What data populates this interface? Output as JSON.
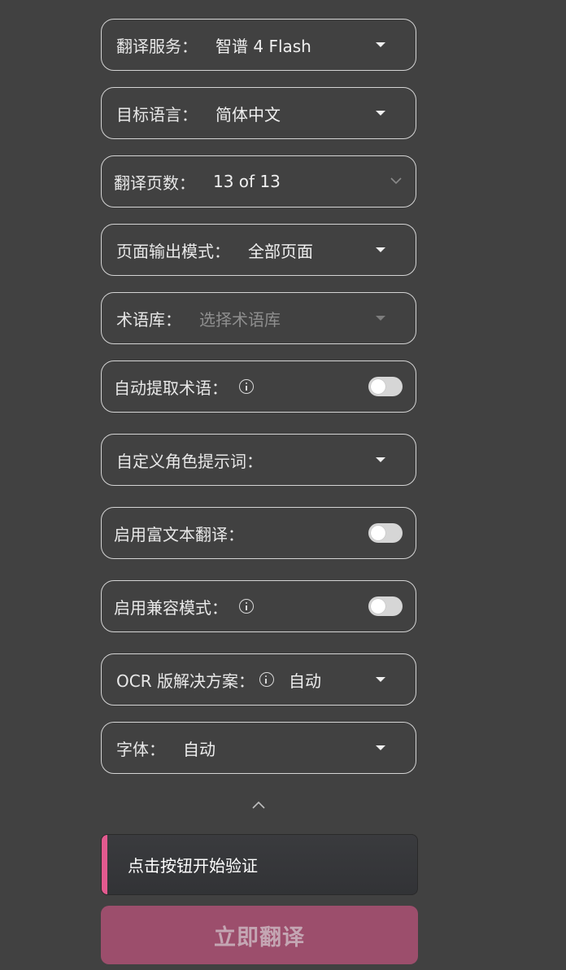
{
  "settings": {
    "translation_service": {
      "label": "翻译服务：",
      "value": "智谱 4 Flash"
    },
    "target_language": {
      "label": "目标语言：",
      "value": "简体中文"
    },
    "pages": {
      "label": "翻译页数：",
      "value": "13 of 13"
    },
    "output_mode": {
      "label": "页面输出模式：",
      "value": "全部页面"
    },
    "glossary": {
      "label": "术语库：",
      "placeholder": "选择术语库"
    },
    "auto_extract_terms": {
      "label": "自动提取术语：",
      "enabled": false
    },
    "custom_prompt": {
      "label": "自定义角色提示词："
    },
    "rich_text": {
      "label": "启用富文本翻译：",
      "enabled": false
    },
    "compat_mode": {
      "label": "启用兼容模式：",
      "enabled": false
    },
    "ocr": {
      "label": "OCR 版解决方案：",
      "value": "自动"
    },
    "font": {
      "label": "字体：",
      "value": "自动"
    }
  },
  "verify": {
    "text": "点击按钮开始验证",
    "accent_color": "#e35a8f"
  },
  "submit": {
    "label": "立即翻译",
    "color": "#9c4e6c"
  },
  "icons": {
    "dropdown": "caret-down-icon",
    "info": "info-circle-icon",
    "collapse": "chevron-up-icon",
    "pages_dropdown": "chevron-down-icon"
  }
}
